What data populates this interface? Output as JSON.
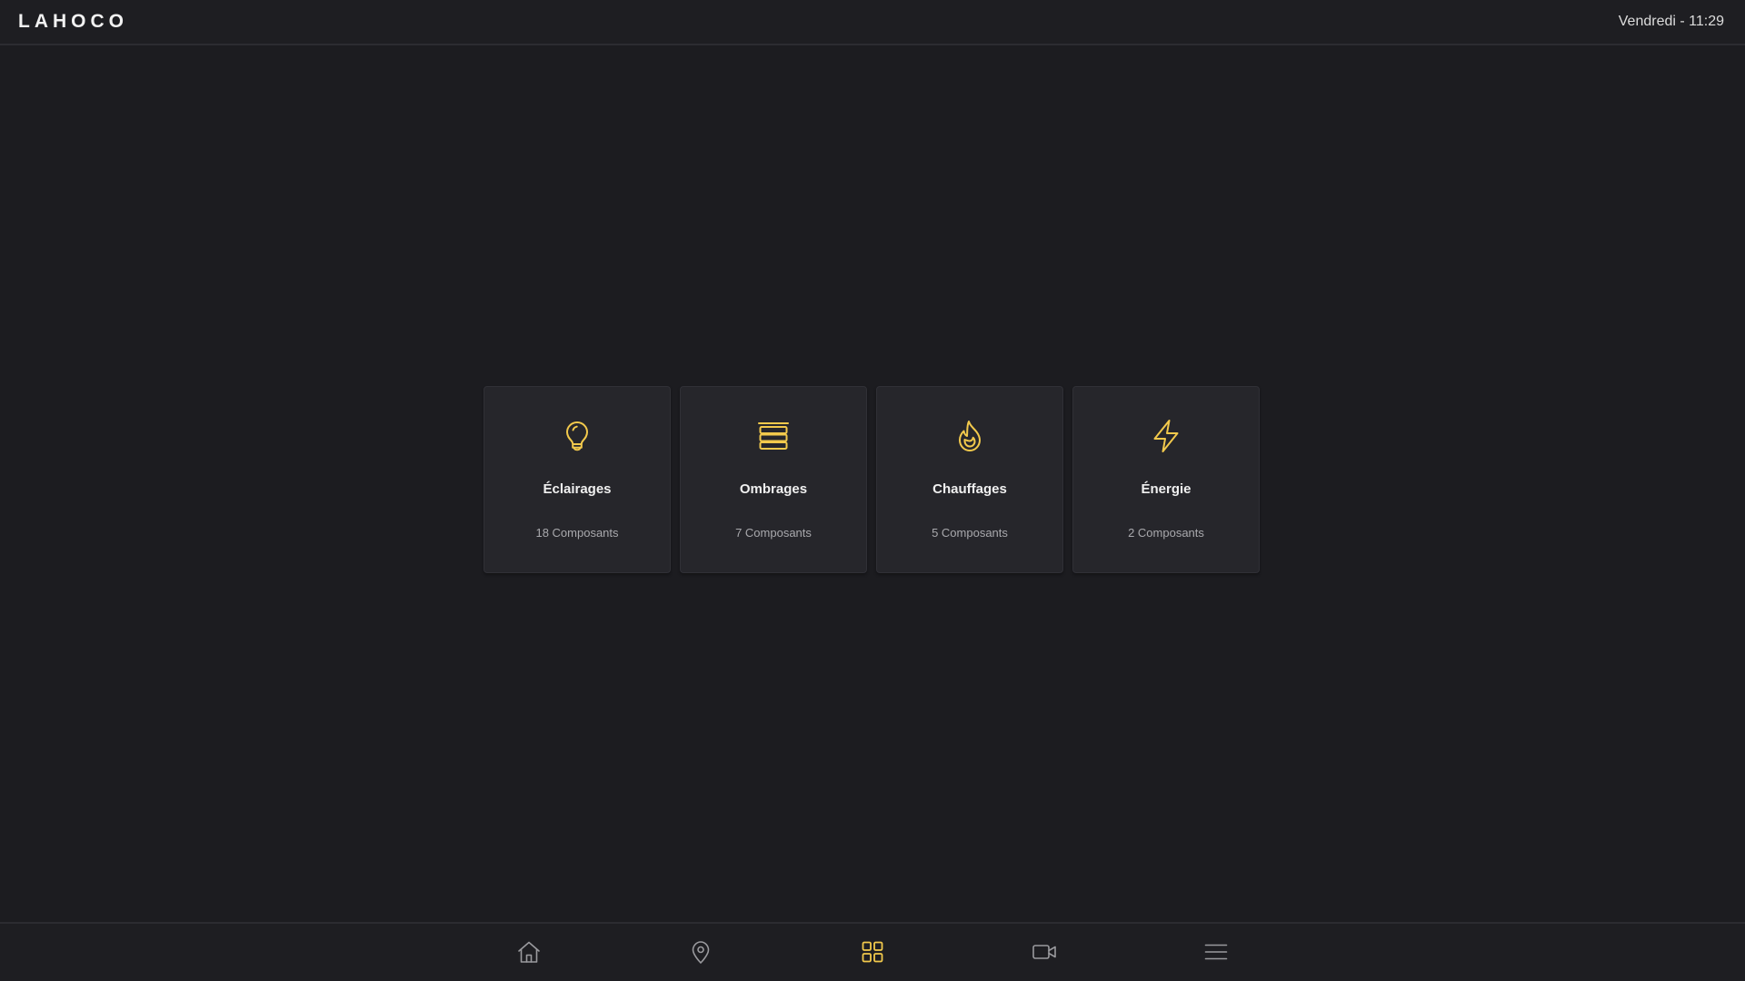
{
  "header": {
    "brand": "LAHOCO",
    "datetime": "Vendredi - 11:29"
  },
  "theme": {
    "accent": "#f2c94c",
    "icon_muted": "#9a9a9e",
    "background": "#1c1c20",
    "card": "#26262b"
  },
  "categories": [
    {
      "icon": "lightbulb-icon",
      "label": "Éclairages",
      "count": "18 Composants"
    },
    {
      "icon": "shutter-icon",
      "label": "Ombrages",
      "count": "7 Composants"
    },
    {
      "icon": "flame-icon",
      "label": "Chauffages",
      "count": "5 Composants"
    },
    {
      "icon": "lightning-icon",
      "label": "Énergie",
      "count": "2 Composants"
    }
  ],
  "bottom_nav": [
    {
      "icon": "home-icon",
      "active": false
    },
    {
      "icon": "location-pin-icon",
      "active": false
    },
    {
      "icon": "grid-icon",
      "active": true
    },
    {
      "icon": "video-camera-icon",
      "active": false
    },
    {
      "icon": "menu-icon",
      "active": false
    }
  ]
}
